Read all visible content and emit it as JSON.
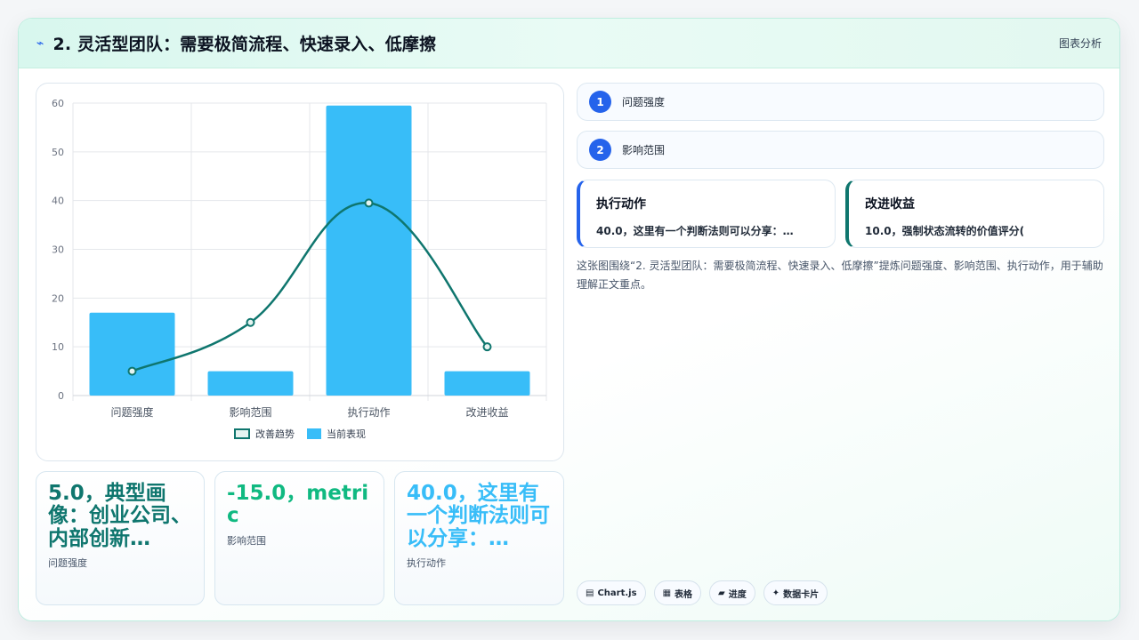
{
  "header": {
    "icon": "⌁",
    "title": "2. 灵活型团队：需要极简流程、快速录入、低摩擦",
    "tag": "图表分析"
  },
  "chart_data": {
    "type": "bar",
    "categories": [
      "问题强度",
      "影响范围",
      "执行动作",
      "改进收益"
    ],
    "series": [
      {
        "name": "改善趋势",
        "type": "line",
        "values": [
          5,
          15,
          39.5,
          10
        ],
        "color": "#0f766e"
      },
      {
        "name": "当前表现",
        "type": "bar",
        "values": [
          17,
          5,
          59.5,
          5
        ],
        "color": "#38bdf8"
      }
    ],
    "ylim": [
      0,
      60
    ],
    "yticks": [
      0,
      10,
      20,
      30,
      40,
      50,
      60
    ],
    "grid": true,
    "legend": "bottom"
  },
  "metrics": [
    {
      "value": "5.0，典型画像：创业公司、内部创新…",
      "label": "问题强度",
      "color": "#0f766e"
    },
    {
      "value": "-15.0，metric",
      "label": "影响范围",
      "color": "#10b981"
    },
    {
      "value": "40.0，这里有一个判断法则可以分享：…",
      "label": "执行动作",
      "color": "#38bdf8"
    }
  ],
  "list": [
    {
      "num": "1",
      "label": "问题强度"
    },
    {
      "num": "2",
      "label": "影响范围"
    }
  ],
  "info_cards": [
    {
      "title": "执行动作",
      "desc": "40.0，这里有一个判断法则可以分享：…",
      "accent": "#2563eb"
    },
    {
      "title": "改进收益",
      "desc": "10.0，强制状态流转的价值评分(",
      "accent": "#0f766e"
    }
  ],
  "summary": "这张图围绕“2. 灵活型团队：需要极简流程、快速录入、低摩擦”提炼问题强度、影响范围、执行动作，用于辅助理解正文重点。",
  "chips": [
    {
      "icon": "▤",
      "label": "Chart.js"
    },
    {
      "icon": "▦",
      "label": "表格"
    },
    {
      "icon": "▰",
      "label": "进度"
    },
    {
      "icon": "✦",
      "label": "数据卡片"
    }
  ]
}
